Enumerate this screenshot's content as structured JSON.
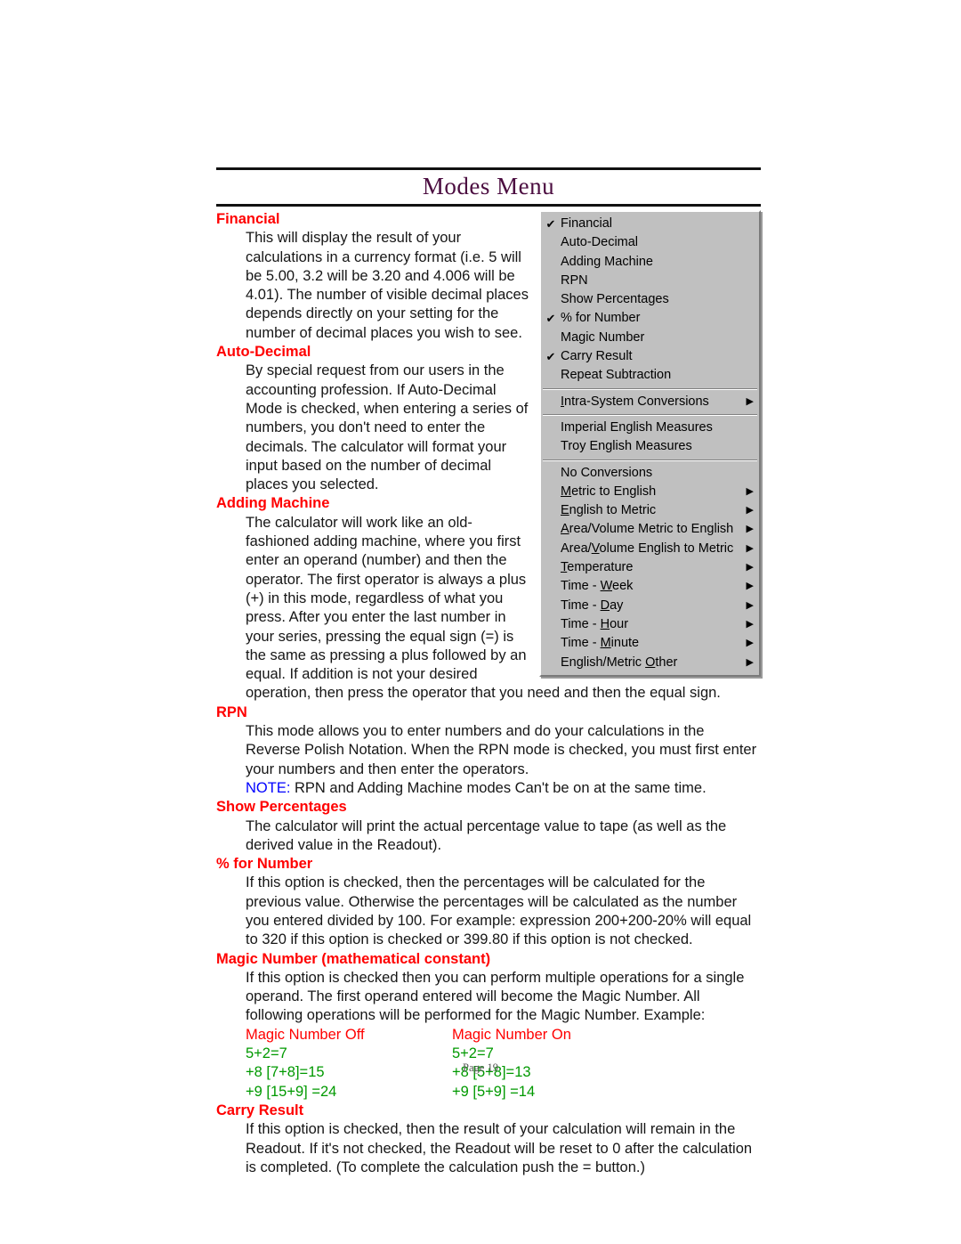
{
  "document": {
    "title": "Modes Menu",
    "footer": "Page 19",
    "colors": {
      "heading": "#ff0000",
      "title": "#4b0d40",
      "note": "#0000ff",
      "example": "#009900",
      "menu_face": "#c0c0c0"
    }
  },
  "sections": [
    {
      "heading": "Financial",
      "body": "This will display the result of your calculations in a currency format (i.e. 5 will be 5.00, 3.2 will be 3.20 and 4.006 will be 4.01).  The number of visible decimal places depends directly on your setting for the number of decimal places you wish to see."
    },
    {
      "heading": "Auto-Decimal",
      "body": "By special request from our users in the accounting profession.  If Auto-Decimal Mode is checked, when entering a series of numbers, you don't need to enter the decimals.  The calculator will format your input based on the number of decimal places you selected."
    },
    {
      "heading": "Adding Machine",
      "body": "The calculator will work like an old-fashioned adding machine, where you first enter an operand (number) and then the operator.  The first operator is always a plus (+) in this mode, regardless of what you press.  After you enter the last number in your series, pressing the equal sign (=) is the same as pressing a plus followed by an equal.  If addition is not your desired operation, then press the operator that you need and then the equal sign."
    },
    {
      "heading": "RPN",
      "body": "This mode allows you to enter numbers and do your calculations in the Reverse Polish Notation.  When the RPN mode is checked, you must first enter your numbers and then enter the operators.",
      "note_label": "NOTE:",
      "note_body": "  RPN and Adding Machine modes Can't be on at the same time."
    },
    {
      "heading": "Show Percentages",
      "body": "The calculator will print the actual percentage value to tape (as well as the derived value in the Readout)."
    },
    {
      "heading": "% for Number",
      "body": "If this option is checked, then the percentages will be calculated for the previous value.  Otherwise the percentages will be calculated as the number you entered divided by 100.  For example: expression 200+200-20% will equal to 320 if this option is checked or 399.80 if this option is not checked."
    },
    {
      "heading": "Magic Number (mathematical constant)",
      "body": "If this option is checked then you can perform multiple operations for a single operand.  The first operand entered will become the Magic Number.  All following operations will be performed for the Magic Number.  Example:"
    },
    {
      "heading": "Carry Result",
      "body": "If this option is checked, then the result of your calculation will remain in the Readout.  If it's not checked, the Readout will be reset to 0 after the calculation is completed.  (To complete the calculation push the = button.)"
    }
  ],
  "example": {
    "col_off_head": "Magic Number Off",
    "col_on_head": "Magic Number On",
    "rows": [
      {
        "off": "5+2=7",
        "on": "5+2=7"
      },
      {
        "off": "+8 [7+8]=15",
        "on": "+8 [5+8]=13"
      },
      {
        "off": "+9 [15+9] =24",
        "on": "+9 [5+9] =14"
      }
    ]
  },
  "menu": {
    "groups": [
      {
        "items": [
          {
            "label": "Financial",
            "checked": true,
            "submenu": false
          },
          {
            "label": "Auto-Decimal",
            "checked": false,
            "submenu": false
          },
          {
            "label": "Adding Machine",
            "checked": false,
            "submenu": false
          },
          {
            "label": "RPN",
            "checked": false,
            "submenu": false
          },
          {
            "label": "Show Percentages",
            "checked": false,
            "submenu": false
          },
          {
            "label": "% for Number",
            "checked": true,
            "submenu": false
          },
          {
            "label": "Magic Number",
            "checked": false,
            "submenu": false
          },
          {
            "label": "Carry Result",
            "checked": true,
            "submenu": false
          },
          {
            "label": "Repeat Subtraction",
            "checked": false,
            "submenu": false
          }
        ]
      },
      {
        "items": [
          {
            "label": "Intra-System Conversions",
            "checked": false,
            "submenu": true,
            "mnemonic": "I"
          }
        ]
      },
      {
        "items": [
          {
            "label": "Imperial English Measures",
            "checked": false,
            "submenu": false
          },
          {
            "label": "Troy English Measures",
            "checked": false,
            "submenu": false
          }
        ]
      },
      {
        "items": [
          {
            "label": "No Conversions",
            "checked": false,
            "submenu": false
          },
          {
            "label": "Metric to English",
            "checked": false,
            "submenu": true,
            "mnemonic": "M"
          },
          {
            "label": "English to Metric",
            "checked": false,
            "submenu": true,
            "mnemonic": "E"
          },
          {
            "label": "Area/Volume Metric to English",
            "checked": false,
            "submenu": true,
            "mnemonic": "A"
          },
          {
            "label": "Area/Volume English to Metric",
            "checked": false,
            "submenu": true,
            "mnemonic": "V"
          },
          {
            "label": "Temperature",
            "checked": false,
            "submenu": true,
            "mnemonic": "T"
          },
          {
            "label": "Time - Week",
            "checked": false,
            "submenu": true,
            "mnemonic": "W"
          },
          {
            "label": "Time - Day",
            "checked": false,
            "submenu": true,
            "mnemonic": "D"
          },
          {
            "label": "Time - Hour",
            "checked": false,
            "submenu": true,
            "mnemonic": "H"
          },
          {
            "label": "Time - Minute",
            "checked": false,
            "submenu": true,
            "mnemonic": "M"
          },
          {
            "label": "English/Metric Other",
            "checked": false,
            "submenu": true,
            "mnemonic": "O"
          }
        ]
      }
    ],
    "check_glyph": "✔",
    "arrow_glyph": "▶"
  }
}
